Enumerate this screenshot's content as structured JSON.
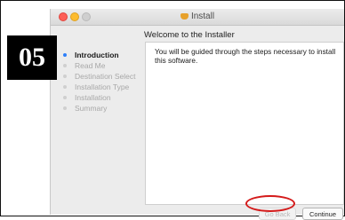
{
  "step_badge": "05",
  "window": {
    "title": "Install",
    "title_icon": "package-icon",
    "traffic_lights": {
      "close": "#fd5f57",
      "minimize": "#fdbc2f",
      "zoom": "#cfcfcf"
    }
  },
  "header": "Welcome to the Installer",
  "sidebar": {
    "items": [
      {
        "label": "Introduction",
        "active": true
      },
      {
        "label": "Read Me",
        "active": false
      },
      {
        "label": "Destination Select",
        "active": false
      },
      {
        "label": "Installation Type",
        "active": false
      },
      {
        "label": "Installation",
        "active": false
      },
      {
        "label": "Summary",
        "active": false
      }
    ],
    "active_color": "#2d7ff9"
  },
  "content": {
    "text": "You will be guided through the steps necessary to install this software."
  },
  "buttons": {
    "go_back": "Go Back",
    "continue": "Continue"
  },
  "highlight_color": "#d41a1a"
}
